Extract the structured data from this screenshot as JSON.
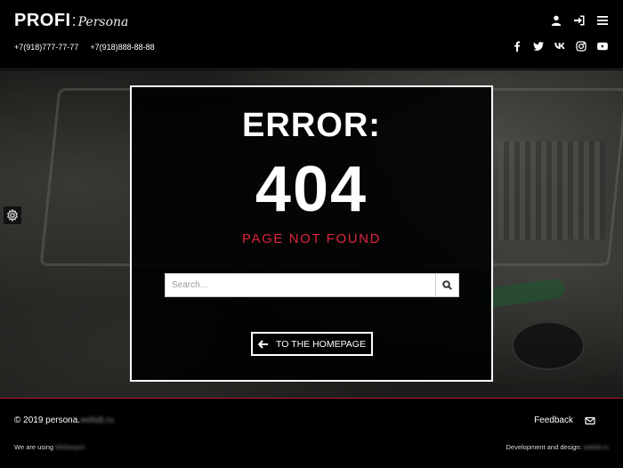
{
  "header": {
    "logo_main": "PROFI",
    "logo_sep": ":",
    "logo_script": "Persona",
    "phones": [
      "+7(918)777-77-77",
      "+7(918)888-88-88"
    ],
    "action_icons": [
      "user-icon",
      "sign-in-icon",
      "menu-icon"
    ],
    "social_icons": [
      "facebook-icon",
      "twitter-icon",
      "vk-icon",
      "instagram-icon",
      "youtube-icon"
    ]
  },
  "error": {
    "title": "ERROR:",
    "code": "404",
    "subtitle": "PAGE NOT FOUND",
    "search_placeholder": "Search...",
    "home_button": "TO THE HOMEPAGE",
    "accent_color": "#e0243e"
  },
  "footer": {
    "copyright": "© 2019 persona.",
    "copyright_blurred": "webdi.ru",
    "feedback": "Feedback",
    "we_using": "We are using",
    "we_using_blurred": "Webasyst",
    "dev": "Development and design:",
    "dev_blurred": "webdi.ru"
  }
}
